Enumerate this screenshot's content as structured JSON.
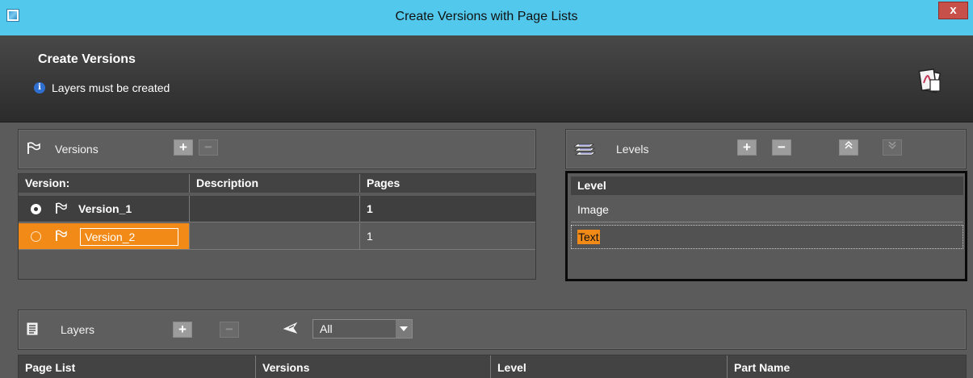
{
  "window": {
    "title": "Create Versions with Page Lists",
    "close_label": "x"
  },
  "header": {
    "title": "Create Versions",
    "info": "Layers must be created"
  },
  "versions": {
    "label": "Versions",
    "add": "+",
    "remove": "−",
    "columns": [
      "Version:",
      "Description",
      "Pages"
    ],
    "rows": [
      {
        "name": "Version_1",
        "description": "",
        "pages": "1",
        "selected": true
      },
      {
        "name": "Version_2",
        "description": "",
        "pages": "1",
        "selected": false
      }
    ]
  },
  "levels": {
    "label": "Levels",
    "add": "+",
    "remove": "−",
    "up": "≈",
    "down": "≈",
    "column": "Level",
    "rows": [
      "Image",
      "Text"
    ]
  },
  "layers": {
    "label": "Layers",
    "add": "+",
    "remove": "−",
    "filter_value": "All",
    "columns": [
      "Page List",
      "Versions",
      "Level",
      "Part Name"
    ]
  }
}
